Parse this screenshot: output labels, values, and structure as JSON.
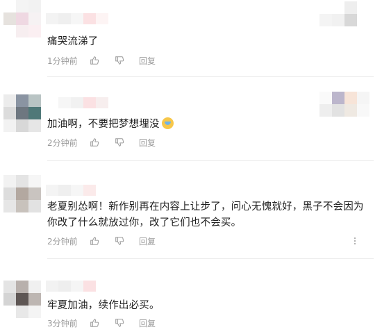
{
  "comments": [
    {
      "text": "痛哭流涕了",
      "time": "1分钟前",
      "reply_label": "回复",
      "has_emoji": false
    },
    {
      "text": "加油啊，不要把梦想埋没",
      "time": "2分钟前",
      "reply_label": "回复",
      "has_emoji": true,
      "emoji_name": "crying-face-icon"
    },
    {
      "text": "老夏别怂啊！新作别再在内容上让步了，问心无愧就好，黑子不会因为你改了什么就放过你，改了它们也不会买。",
      "time": "2分钟前",
      "reply_label": "回复",
      "has_emoji": false
    },
    {
      "text": "牢夏加油，续作出必买。",
      "time": "3分钟前",
      "reply_label": "回复",
      "has_emoji": false
    }
  ],
  "icons": {
    "like": "thumbs-up-icon",
    "dislike": "thumbs-down-icon",
    "more": "more-vertical-icon"
  }
}
